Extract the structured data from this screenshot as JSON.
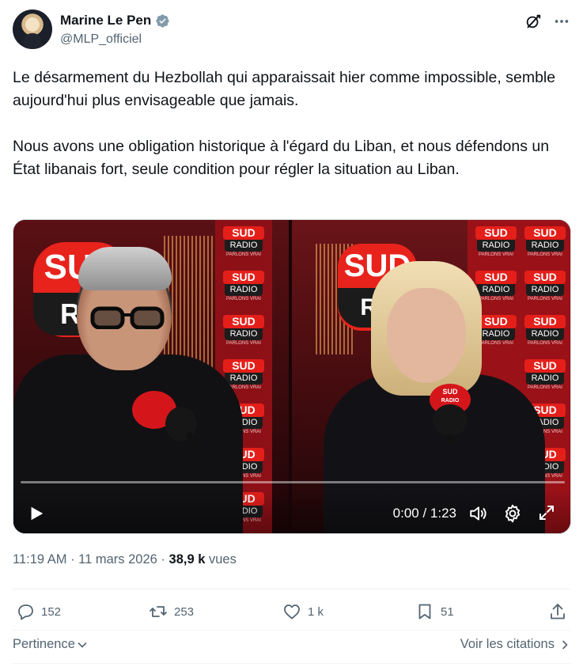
{
  "author": {
    "display_name": "Marine Le Pen",
    "handle": "@MLP_officiel"
  },
  "tweet": {
    "paragraphs": [
      "Le désarmement du Hezbollah qui apparaissait hier comme impossible, semble aujourd'hui plus envisageable que jamais.",
      "Nous avons une obligation historique à l'égard du Liban, et nous défendons un État libanais fort, seule condition pour régler la situation au Liban."
    ]
  },
  "video": {
    "logo_sud": "SUD",
    "logo_radio": "RADIO",
    "logo_partial_left": "RA",
    "logo_partial_right": "RA",
    "tile_sud": "SUD",
    "tile_radio": "RADIO",
    "tile_tagline": "PARLONS VRAI",
    "mic_sud": "SUD",
    "mic_radio": "RADIO",
    "current_time": "0:00",
    "time_separator": " / ",
    "duration": "1:23",
    "progress": 0
  },
  "meta": {
    "time": "11:19 AM",
    "dot": " · ",
    "date": "11 mars 2026",
    "views_count": "38,9 k",
    "views_label": " vues"
  },
  "actions": {
    "replies": "152",
    "reposts": "253",
    "likes": "1 k",
    "bookmarks": "51"
  },
  "footer": {
    "sort_label": "Pertinence",
    "quotes_label": "Voir les citations"
  },
  "colors": {
    "text": "#0f1419",
    "secondary": "#536471",
    "verified": "#829aab",
    "brand_red": "#e41f1a"
  }
}
